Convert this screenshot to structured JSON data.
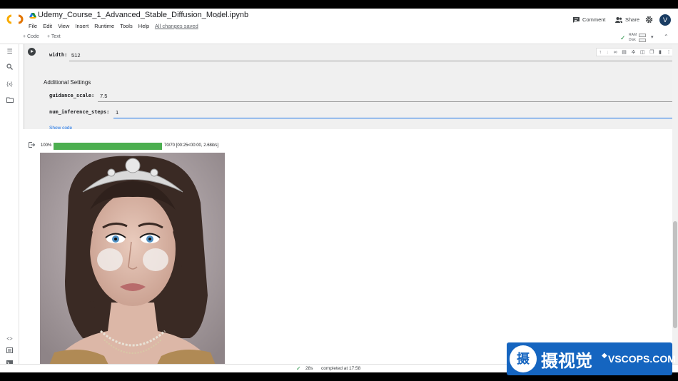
{
  "header": {
    "notebook_title": "Udemy_Course_1_Advanced_Stable_Diffusion_Model.ipynb",
    "menu": [
      "File",
      "Edit",
      "View",
      "Insert",
      "Runtime",
      "Tools",
      "Help"
    ],
    "save_status": "All changes saved",
    "comment_label": "Comment",
    "share_label": "Share",
    "avatar_letter": "V"
  },
  "toolbar": {
    "add_code": "+ Code",
    "add_text": "+ Text",
    "ram_label": "RAM",
    "disk_label": "Disk"
  },
  "form": {
    "width_label": "width:",
    "width_value": "512",
    "section_title": "Additional Settings",
    "guidance_label": "guidance_scale:",
    "guidance_value": "7.5",
    "steps_label": "num_inference_steps:",
    "steps_value": "1",
    "show_code": "Show code"
  },
  "output": {
    "progress_percent_text": "100%",
    "progress_fraction": 1.0,
    "progress_info": "70/70 [00:25<00:00, 2.68it/s]"
  },
  "status": {
    "elapsed": "28s",
    "completed": "completed at 17:58"
  },
  "watermark": {
    "logo_char": "摄",
    "text_cn": "摄视觉",
    "text_en": "VSCOPS.COM"
  },
  "colors": {
    "accent": "#1a73e8",
    "progress": "#4caf50",
    "colab_orange": "#f9ab00",
    "watermark_blue": "#1565c0"
  }
}
